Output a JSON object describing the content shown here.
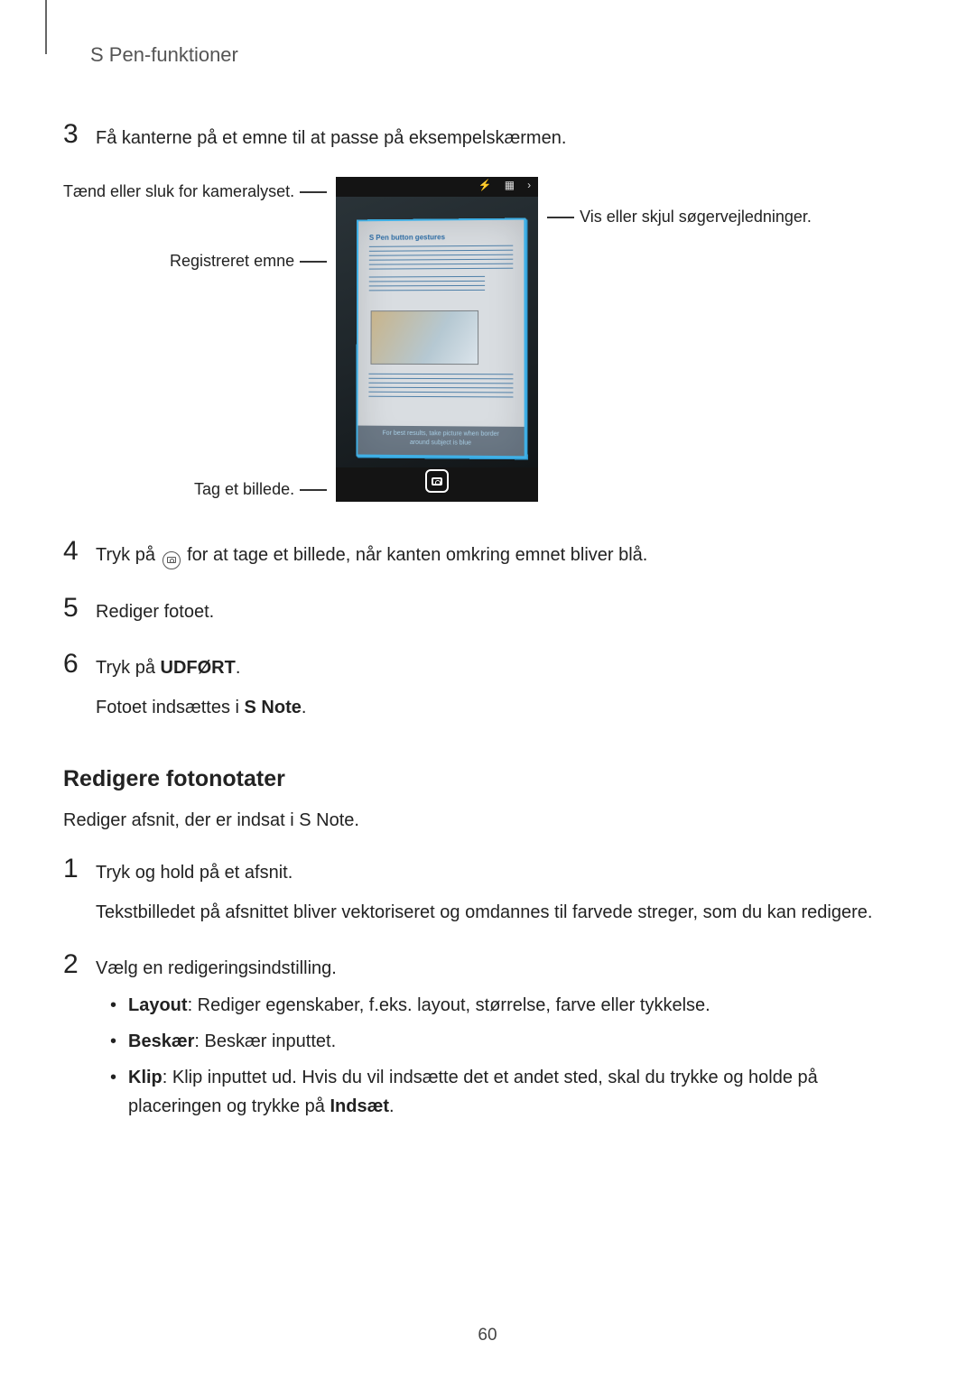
{
  "header": {
    "section_title": "S Pen-funktioner"
  },
  "steps_a": {
    "3": "Få kanterne på et emne til at passe på eksempelskærmen.",
    "4_pre": "Tryk på ",
    "4_post": " for at tage et billede, når kanten omkring emnet bliver blå.",
    "5": "Rediger fotoet.",
    "6_line1_pre": "Tryk på ",
    "6_line1_strong": "UDFØRT",
    "6_line1_post": ".",
    "6_line2_pre": "Fotoet indsættes i ",
    "6_line2_strong": "S Note",
    "6_line2_post": "."
  },
  "callouts": {
    "flash": "Tænd eller sluk for kameralyset.",
    "subject": "Registreret emne",
    "capture": "Tag et billede.",
    "guides": "Vis eller skjul søgervejledninger."
  },
  "phone": {
    "doc_heading": "S Pen button gestures",
    "hint_l1": "For best results, take picture when border",
    "hint_l2": "around subject is blue"
  },
  "section_b": {
    "heading": "Redigere fotonotater",
    "intro": "Rediger afsnit, der er indsat i S Note.",
    "1_l1": "Tryk og hold på et afsnit.",
    "1_l2": "Tekstbilledet på afsnittet bliver vektoriseret og omdannes til farvede streger, som du kan redigere.",
    "2": "Vælg en redigeringsindstilling.",
    "bullets": {
      "layout_label": "Layout",
      "layout_text": ": Rediger egenskaber, f.eks. layout, størrelse, farve eller tykkelse.",
      "crop_label": "Beskær",
      "crop_text": ": Beskær inputtet.",
      "clip_label": "Klip",
      "clip_text_pre": ": Klip inputtet ud. Hvis du vil indsætte det et andet sted, skal du trykke og holde på placeringen og trykke på ",
      "clip_text_strong": "Indsæt",
      "clip_text_post": "."
    }
  },
  "page_number": "60"
}
